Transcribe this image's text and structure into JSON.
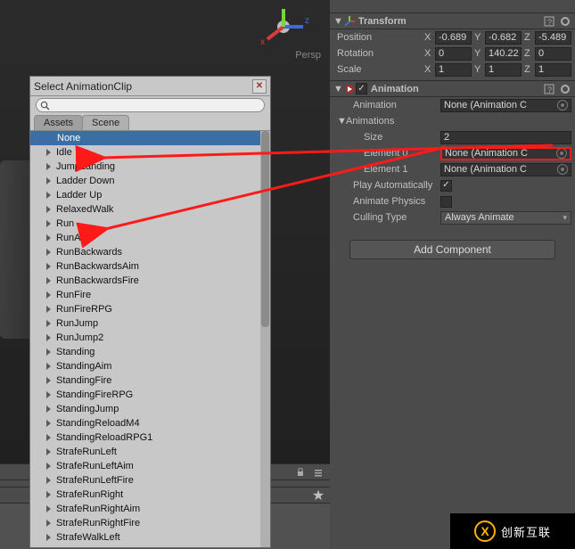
{
  "scene": {
    "persp_label": "Persp"
  },
  "inspector": {
    "transform": {
      "title": "Transform",
      "position_label": "Position",
      "rotation_label": "Rotation",
      "scale_label": "Scale",
      "labels": {
        "x": "X",
        "y": "Y",
        "z": "Z"
      },
      "position": {
        "x": "-0.689",
        "y": "-0.682",
        "z": "-5.489"
      },
      "rotation": {
        "x": "0",
        "y": "140.22",
        "z": "0"
      },
      "scale": {
        "x": "1",
        "y": "1",
        "z": "1"
      }
    },
    "animation": {
      "title": "Animation",
      "animation_label": "Animation",
      "animation_value": "None (Animation C",
      "animations_label": "Animations",
      "size_label": "Size",
      "size_value": "2",
      "element0_label": "Element 0",
      "element0_value": "None (Animation C",
      "element1_label": "Element 1",
      "element1_value": "None (Animation C",
      "play_auto_label": "Play Automatically",
      "play_auto_checked": true,
      "animate_physics_label": "Animate Physics",
      "animate_physics_checked": false,
      "culling_label": "Culling Type",
      "culling_value": "Always Animate"
    },
    "add_component": "Add Component"
  },
  "picker": {
    "title": "Select AnimationClip",
    "tabs": {
      "assets": "Assets",
      "scene": "Scene"
    },
    "none": "None",
    "search_placeholder": "",
    "items": [
      "Idle",
      "JumpLanding",
      "Ladder Down",
      "Ladder Up",
      "RelaxedWalk",
      "Run",
      "RunAim",
      "RunBackwards",
      "RunBackwardsAim",
      "RunBackwardsFire",
      "RunFire",
      "RunFireRPG",
      "RunJump",
      "RunJump2",
      "Standing",
      "StandingAim",
      "StandingFire",
      "StandingFireRPG",
      "StandingJump",
      "StandingReloadM4",
      "StandingReloadRPG1",
      "StrafeRunLeft",
      "StrafeRunLeftAim",
      "StrafeRunLeftFire",
      "StrafeRunRight",
      "StrafeRunRightAim",
      "StrafeRunRightFire",
      "StrafeWalkLeft"
    ]
  },
  "watermark": {
    "main": "创新互联",
    "logo": "X"
  }
}
